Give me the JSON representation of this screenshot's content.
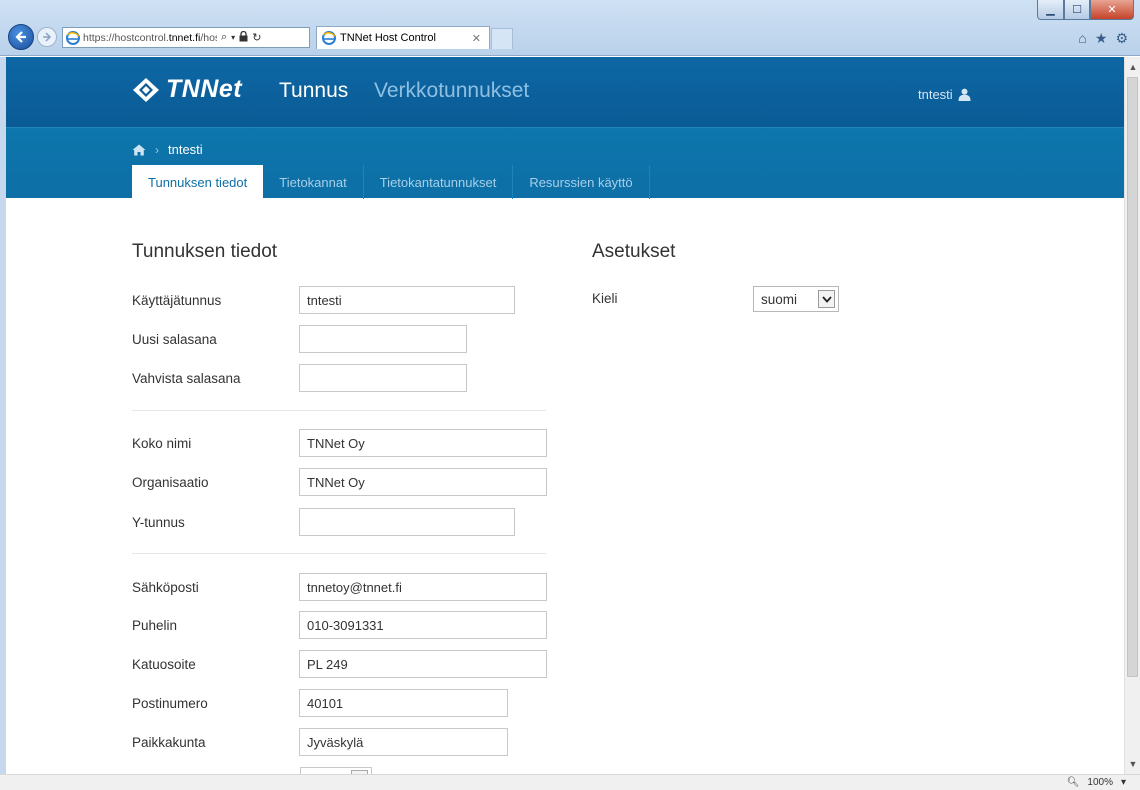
{
  "browser": {
    "url_prefix": "https://hostcontrol.",
    "url_domain": "tnnet.fi",
    "url_suffix": "/hoster",
    "tab_title": "TNNet Host Control",
    "zoom": "100%"
  },
  "header": {
    "logo": "TNNet",
    "nav_active": "Tunnus",
    "nav_secondary": "Verkkotunnukset",
    "user": "tntesti"
  },
  "breadcrumb": {
    "current": "tntesti"
  },
  "tabs": [
    {
      "label": "Tunnuksen tiedot",
      "active": true
    },
    {
      "label": "Tietokannat",
      "active": false
    },
    {
      "label": "Tietokantatunnukset",
      "active": false
    },
    {
      "label": "Resurssien käyttö",
      "active": false
    }
  ],
  "account": {
    "heading": "Tunnuksen tiedot",
    "fields": [
      {
        "label": "Käyttäjätunnus",
        "value": "tntesti"
      },
      {
        "label": "Uusi salasana",
        "value": ""
      },
      {
        "label": "Vahvista salasana",
        "value": ""
      },
      {
        "label": "Koko nimi",
        "value": "TNNet Oy"
      },
      {
        "label": "Organisaatio",
        "value": "TNNet Oy"
      },
      {
        "label": "Y-tunnus",
        "value": ""
      },
      {
        "label": "Sähköposti",
        "value": "tnnetoy@tnnet.fi"
      },
      {
        "label": "Puhelin",
        "value": "010-3091331"
      },
      {
        "label": "Katuosoite",
        "value": "PL 249"
      },
      {
        "label": "Postinumero",
        "value": "40101"
      },
      {
        "label": "Paikkakunta",
        "value": "Jyväskylä"
      }
    ]
  },
  "settings": {
    "heading": "Asetukset",
    "language_label": "Kieli",
    "language_value": "suomi"
  },
  "colors": {
    "header": "#0a5b95",
    "subheader": "#0d6fa6",
    "tab_active_text": "#0d6fa6"
  }
}
